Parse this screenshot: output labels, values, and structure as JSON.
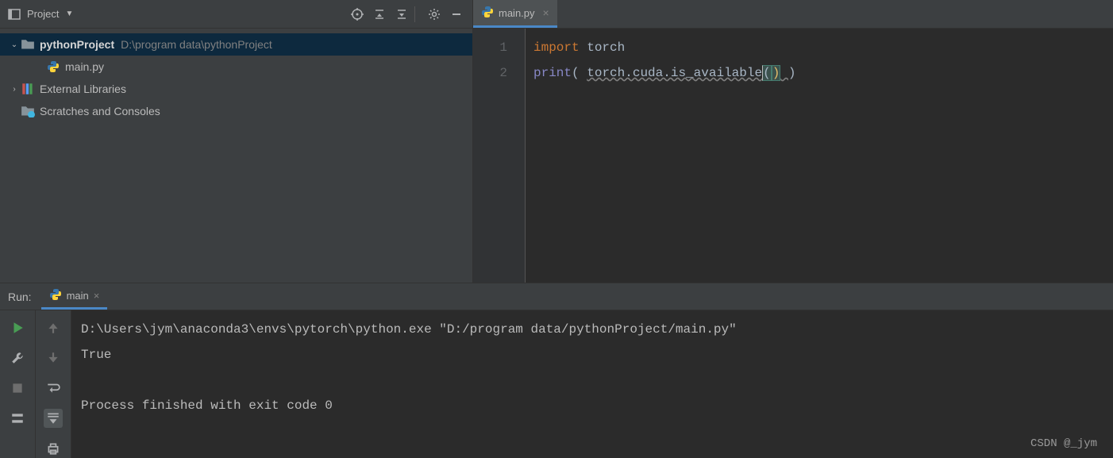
{
  "project": {
    "panel_title": "Project",
    "root_name": "pythonProject",
    "root_path": "D:\\program data\\pythonProject",
    "file": "main.py",
    "ext_libs": "External Libraries",
    "scratches": "Scratches and Consoles"
  },
  "editor": {
    "tab_label": "main.py",
    "gutter": [
      "1",
      "2"
    ],
    "line1": {
      "kw": "import",
      "rest": " torch"
    },
    "line2": {
      "fn": "print",
      "open1": "(",
      "sp1": " ",
      "body": "torch.cuda.is_available",
      "open2": "(",
      "close2": ")",
      "sp2": " ",
      "close1": ")"
    }
  },
  "run": {
    "label": "Run:",
    "tab": "main",
    "out1": "D:\\Users\\jym\\anaconda3\\envs\\pytorch\\python.exe \"D:/program data/pythonProject/main.py\"",
    "out2": "True",
    "out3": "",
    "out4": "Process finished with exit code 0"
  },
  "watermark": "CSDN @_jym"
}
